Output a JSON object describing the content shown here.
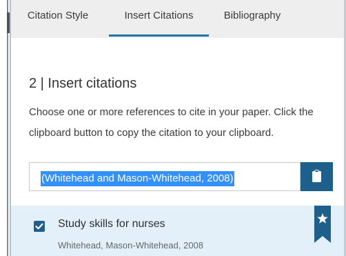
{
  "tabs": [
    {
      "label": "Citation Style",
      "active": false
    },
    {
      "label": "Insert Citations",
      "active": true
    },
    {
      "label": "Bibliography",
      "active": false
    }
  ],
  "section": {
    "title": "2 | Insert citations",
    "instructions": "Choose one or more references to cite in your paper. Click the clipboard button to copy the citation to your clipboard."
  },
  "citation": {
    "value": "(Whitehead and Mason-Whitehead, 2008)",
    "copy_icon": "clipboard-icon"
  },
  "references": [
    {
      "title": "Study skills for nurses",
      "authors": "Whitehead, Mason-Whitehead, 2008",
      "checked": true,
      "bookmark_icon": "star-bookmark-icon"
    }
  ],
  "colors": {
    "accent": "#1f74a7",
    "button": "#1f5f8b",
    "selection": "#3390ff",
    "item_background": "#e4f0f9",
    "tabbar": "#eeeeee"
  }
}
